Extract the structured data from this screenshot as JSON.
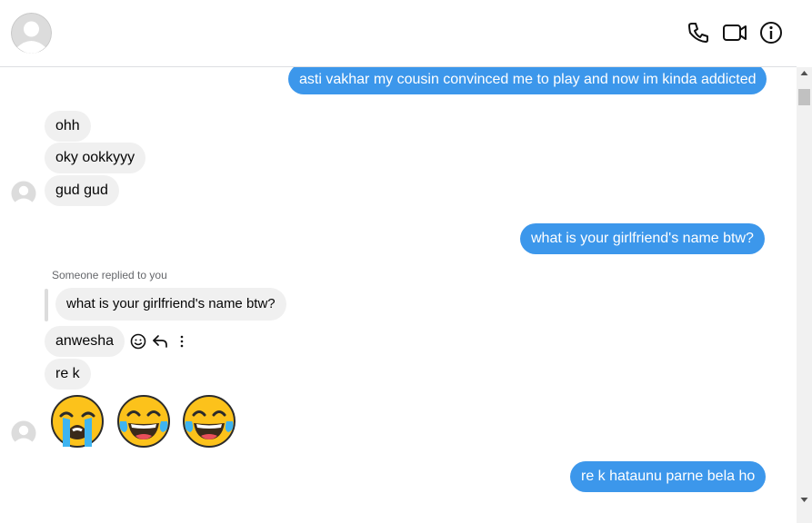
{
  "header": {
    "avatar_icon": "default-user-avatar-icon",
    "actions": [
      {
        "name": "call",
        "icon": "phone-icon"
      },
      {
        "name": "video",
        "icon": "video-camera-icon"
      },
      {
        "name": "info",
        "icon": "info-icon"
      }
    ]
  },
  "messages": {
    "m1_out": "asti vakhar my cousin convinced me to play and now im kinda addicted",
    "m2_in": "ohh",
    "m3_in": "oky ookkyyy",
    "m4_in": "gud gud",
    "m5_out": "what is your girlfriend's name btw?",
    "reply_note": "Someone replied to you",
    "reply_quoted": "what is your girlfriend's name btw?",
    "m6_in": "anwesha",
    "m7_in": "re k",
    "m8_emojis": [
      "loudly-crying-face",
      "face-with-tears-of-joy",
      "face-with-tears-of-joy"
    ],
    "m9_out": "re k hataunu parne bela ho"
  },
  "message_actions": [
    "react-icon",
    "reply-icon",
    "more-options-icon"
  ],
  "colors": {
    "outgoing_bubble": "#3c97eb",
    "incoming_bubble": "#f0f0f0",
    "secondary_text": "#65676b"
  }
}
